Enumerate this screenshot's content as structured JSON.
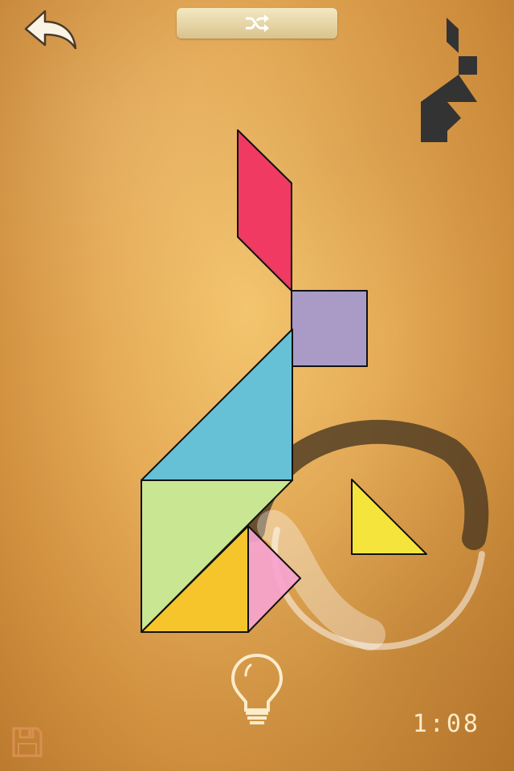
{
  "header": {
    "back_icon": "back-arrow-icon",
    "shuffle_icon": "shuffle-icon"
  },
  "target_preview": {
    "icon": "tangram-silhouette-icon",
    "color": "#333333"
  },
  "pieces": [
    {
      "id": "parallelogram",
      "color": "#f03a62"
    },
    {
      "id": "square",
      "color": "#a99ac6"
    },
    {
      "id": "large-triangle-blue",
      "color": "#67c1d6"
    },
    {
      "id": "large-triangle-green",
      "color": "#c9e693"
    },
    {
      "id": "medium-triangle-orange",
      "color": "#f6c52c"
    },
    {
      "id": "small-triangle-pink",
      "color": "#f6a3cf"
    },
    {
      "id": "small-triangle-yellow",
      "color": "#f5e43c"
    }
  ],
  "footer": {
    "hint_icon": "lightbulb-icon",
    "save_icon": "save-disk-icon",
    "timer": "1:08"
  }
}
